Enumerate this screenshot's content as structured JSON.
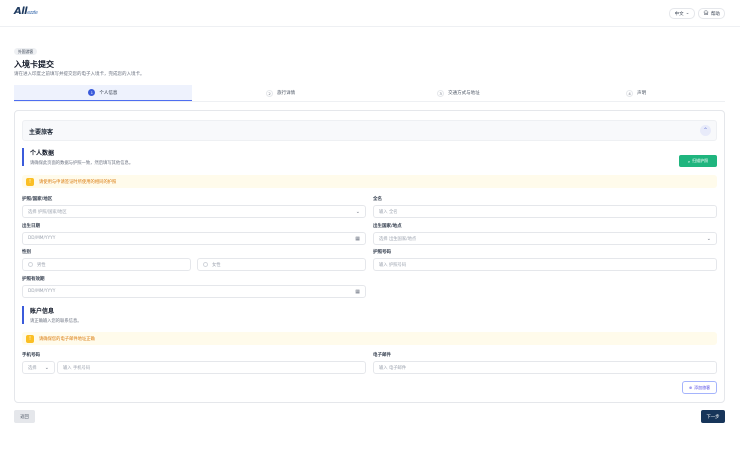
{
  "header": {
    "logo": "All",
    "logo_sub": "ezzle",
    "language": "中文",
    "help": "帮助"
  },
  "page": {
    "badge": "外国游客",
    "title": "入境卡提交",
    "subtitle": "请在进入印度之前填写并提交您的电子入境卡，完成您的入境卡。"
  },
  "steps": [
    {
      "num": "1",
      "label": "个人信息"
    },
    {
      "num": "2",
      "label": "旅行详情"
    },
    {
      "num": "3",
      "label": "交通方式与地址"
    },
    {
      "num": "4",
      "label": "声明"
    }
  ],
  "section": {
    "title": "主要旅客"
  },
  "personal": {
    "title": "个人数据",
    "desc": "请确保此页面的数据与护照一致，然后填写其他信息。",
    "scan_button": "扫描护照",
    "alert": "请使用与申请签证时所使用的相同的护照",
    "fields": {
      "nationality": {
        "label": "护照/国家/地区",
        "placeholder": "选择 护照/国家/地区"
      },
      "full_name": {
        "label": "全名",
        "placeholder": "输入 全名"
      },
      "dob": {
        "label": "出生日期",
        "placeholder": "DD/MM/YYYY"
      },
      "birth_place": {
        "label": "出生国家/地点",
        "placeholder": "选择 出生国家/地点"
      },
      "gender": {
        "label": "性别",
        "male": "男性",
        "female": "女性"
      },
      "passport_no": {
        "label": "护照号码",
        "placeholder": "输入 护照号码"
      },
      "passport_expiry": {
        "label": "护照有效期",
        "placeholder": "DD/MM/YYYY"
      }
    }
  },
  "account": {
    "title": "账户信息",
    "desc": "请正确输入您的联系信息。",
    "alert": "请确保您的电子邮件地址正确",
    "phone": {
      "label": "手机号码",
      "code": "选择",
      "placeholder": "输入 手机号码"
    },
    "email": {
      "label": "电子邮件",
      "placeholder": "输入 电子邮件"
    },
    "add_button": "添加旅客"
  },
  "footer": {
    "back": "返回",
    "next": "下一步"
  }
}
